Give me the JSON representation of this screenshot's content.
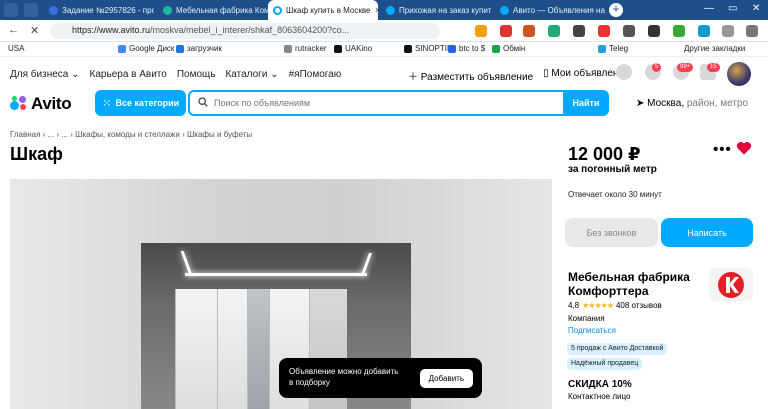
{
  "browser": {
    "tabs": [
      {
        "title": "Задание №2957826 - про",
        "fav": "#3b6fe0"
      },
      {
        "title": "Мебельная фабрика Комф",
        "fav": "#1fb6a0"
      },
      {
        "title": "Шкаф купить в Москве",
        "fav": "#00aaff"
      },
      {
        "title": "Прихожая на заказ купит",
        "fav": "#00aaff"
      },
      {
        "title": "Авито — Объявления на са",
        "fav": "#00aaff"
      }
    ],
    "url_host": "https://www.avito.ru",
    "url_path": "/moskva/mebel_i_interer/shkaf_8063604200?co...",
    "bookmarks": [
      "USA",
      "Google Диск",
      "загрузчик",
      "rutracker",
      "UAKino",
      "SINOPTIK",
      "btc to $",
      "Обмін",
      "Teleg",
      "Другие закладки"
    ]
  },
  "header": {
    "top_links": [
      "Для бизнеса",
      "Карьера в Авито",
      "Помощь",
      "Каталоги",
      "#яПомогаю"
    ],
    "post_ad": "Разместить объявление",
    "my_ads": "Мои объявления",
    "badges": {
      "notifications": "5",
      "messages": "99+",
      "cart": "15"
    },
    "logo": "Avito",
    "categories_button": "Все категории",
    "search_placeholder": "Поиск по объявлениям",
    "search_button": "Найти",
    "location_city": "Москва,",
    "location_hint": "район, метро"
  },
  "breadcrumb": "Главная  ›  ...  ›  ...  ›  Шкафы, комоды и стеллажи  ›  Шкафы и буфеты",
  "listing": {
    "title": "Шкаф",
    "price": "12 000 ₽",
    "price_unit": "за погонный метр",
    "reply_time": "Отвечает около 30 минут",
    "no_calls_button": "Без звонков",
    "write_button": "Написать"
  },
  "seller": {
    "name": "Мебельная фабрика Комфорттера",
    "rating": "4,8",
    "stars": "★★★★★",
    "reviews": "408 отзывов",
    "type": "Компания",
    "subscribe": "Подписаться",
    "chip_sales": "5 продаж с Авито Доставкой",
    "chip_reliable": "Надёжный продавец",
    "discount": "СКИДКА 10%",
    "contact": "Контактное лицо"
  },
  "toast": {
    "text": "Объявление можно добавить в подборку",
    "button": "Добавить"
  },
  "colors": {
    "accent": "#00aaff",
    "danger": "#ff4053",
    "heart": "#e4083a"
  }
}
